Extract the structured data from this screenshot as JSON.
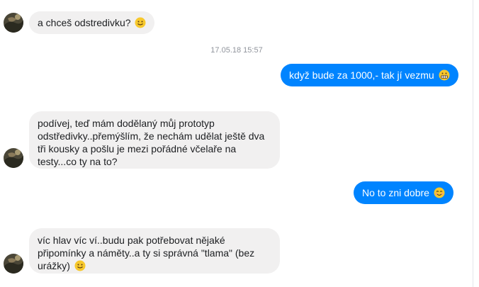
{
  "messages": [
    {
      "side": "in",
      "text": "a chceš odstredivku?",
      "emoji": "slightly-smiling-face"
    },
    {
      "side": "out",
      "text": "když bude za 1000,- tak jí vezmu",
      "emoji": "grimacing-face"
    },
    {
      "side": "in",
      "text": "podívej, teď mám dodělaný můj prototyp odstředivky..přemýšlím, že nechám udělat ještě dva tři kousky a pošlu je mezi pořádné včelaře na testy...co ty na to?"
    },
    {
      "side": "out",
      "text": "No to zni dobre",
      "emoji": "smiling-face-with-smiling-eyes"
    },
    {
      "side": "in",
      "text": "víc hlav víc ví..budu pak potřebovat nějaké připomínky a náměty..a ty si správná \"tlama\" (bez urážky)",
      "emoji": "slightly-smiling-face"
    }
  ],
  "timestamp": "17.05.18 15:57",
  "colors": {
    "outgoing_bubble": "#0084ff",
    "incoming_bubble": "#f1f0f0",
    "timestamp_text": "#90949c"
  }
}
